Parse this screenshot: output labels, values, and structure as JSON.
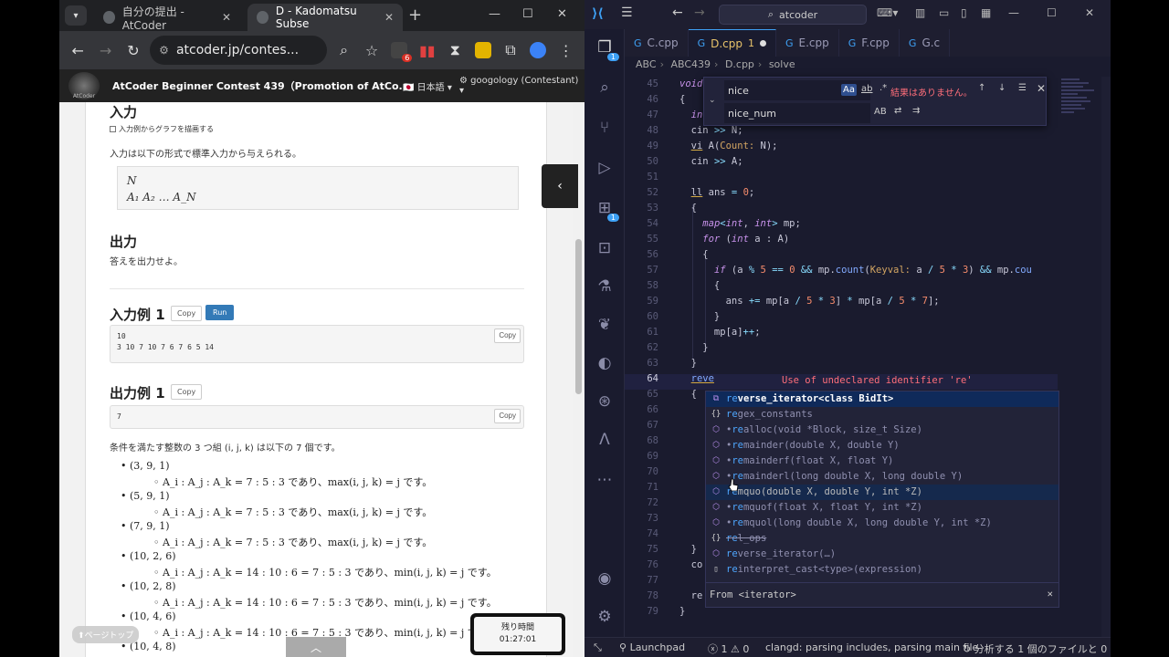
{
  "chrome": {
    "tabs": [
      {
        "title": "自分の提出 - AtCoder",
        "active": false
      },
      {
        "title": "D - Kadomatsu Subse",
        "active": true
      }
    ],
    "url": "atcoder.jp/contes...",
    "ext_badge": "6"
  },
  "atcoder": {
    "logo_text": "AtCoder",
    "contest_title": "AtCoder Beginner Contest 439（Promotion of AtCo...",
    "lang": "日本語",
    "user": "googology (Contestant)",
    "input_heading": "入力",
    "graph_checkbox": "入力例からグラフを描画する",
    "input_desc": "入力は以下の形式で標準入力から与えられる。",
    "format_line1": "N",
    "format_line2": "A₁  A₂  …  A_N",
    "output_heading": "出力",
    "output_desc": "答えを出力せよ。",
    "sample_in_heading": "入力例 1",
    "copy": "Copy",
    "run": "Run",
    "sample_in_line1": "10",
    "sample_in_line2": "3 10 7 10 7 6 7 6 5 14",
    "sample_out_heading": "出力例 1",
    "sample_out": "7",
    "explain": "条件を満たす整数の 3 つ組 (i, j, k) は以下の 7 個です。",
    "items": [
      {
        "tuple": "(3, 9, 1)",
        "detail": "A_i : A_j : A_k = 7 : 5 : 3 であり、max(i, j, k) = j です。"
      },
      {
        "tuple": "(5, 9, 1)",
        "detail": "A_i : A_j : A_k = 7 : 5 : 3 であり、max(i, j, k) = j です。"
      },
      {
        "tuple": "(7, 9, 1)",
        "detail": "A_i : A_j : A_k = 7 : 5 : 3 であり、max(i, j, k) = j です。"
      },
      {
        "tuple": "(10, 2, 6)",
        "detail": "A_i : A_j : A_k = 14 : 10 : 6 = 7 : 5 : 3 であり、min(i, j, k) = j です。"
      },
      {
        "tuple": "(10, 2, 8)",
        "detail": "A_i : A_j : A_k = 14 : 10 : 6 = 7 : 5 : 3 であり、min(i, j, k) = j です。"
      },
      {
        "tuple": "(10, 4, 6)",
        "detail": "A_i : A_j : A_k = 14 : 10 : 6 = 7 : 5 : 3 であり、min(i, j, k) = j で"
      },
      {
        "tuple": "(10, 4, 8)",
        "detail": ""
      }
    ],
    "pagetop": "⬆ページトップ",
    "timer_label": "残り時間",
    "timer_value": "01:27:01"
  },
  "vscode": {
    "search": "atcoder",
    "tabs": [
      {
        "name": "C.cpp"
      },
      {
        "name": "D.cpp",
        "problems": "1"
      },
      {
        "name": "E.cpp"
      },
      {
        "name": "F.cpp"
      },
      {
        "name": "G.c"
      }
    ],
    "breadcrumb": [
      "ABC",
      "ABC439",
      "D.cpp",
      "solve"
    ],
    "find": {
      "query": "nice",
      "replace": "nice_num",
      "no_results": "結果はありません。",
      "opt_case": "Aa",
      "opt_word": "ab",
      "opt_regex": ".*",
      "opt_preserve": "AB"
    },
    "error_msg": "Use of undeclared identifier 're'",
    "suggestions": [
      {
        "icon": "class",
        "label": "reverse_iterator<class BidIt>",
        "match": "re",
        "selected": true
      },
      {
        "icon": "namespace",
        "label": "regex_constants",
        "match": "re"
      },
      {
        "icon": "function",
        "label": "realloc(void *Block, size_t Size)",
        "match": "re"
      },
      {
        "icon": "function",
        "label": "remainder(double X, double Y)",
        "match": "re"
      },
      {
        "icon": "function",
        "label": "remainderf(float X, float Y)",
        "match": "re"
      },
      {
        "icon": "function",
        "label": "remainderl(long double X, long double Y)",
        "match": "re"
      },
      {
        "icon": "function",
        "label": "remquo(double X, double Y, int *Z)",
        "match": "re",
        "hover": true
      },
      {
        "icon": "function",
        "label": "remquof(float X, float Y, int *Z)",
        "match": "re"
      },
      {
        "icon": "function",
        "label": "remquol(long double X, long double Y, int *Z)",
        "match": "re"
      },
      {
        "icon": "namespace",
        "label": "rel_ops",
        "match": "re",
        "strike": true
      },
      {
        "icon": "class",
        "label": "reverse_iterator(…)",
        "match": "re"
      },
      {
        "icon": "keyword",
        "label": "reinterpret_cast<type>(expression)",
        "match": "re"
      }
    ],
    "suggest_detail": "From <iterator>",
    "status": {
      "launchpad": "Launchpad",
      "errors": "1",
      "warnings": "0",
      "clangd": "clangd: parsing includes, parsing main file",
      "analysis": "分析する 1 個のファイルと 0 個のセ"
    }
  }
}
